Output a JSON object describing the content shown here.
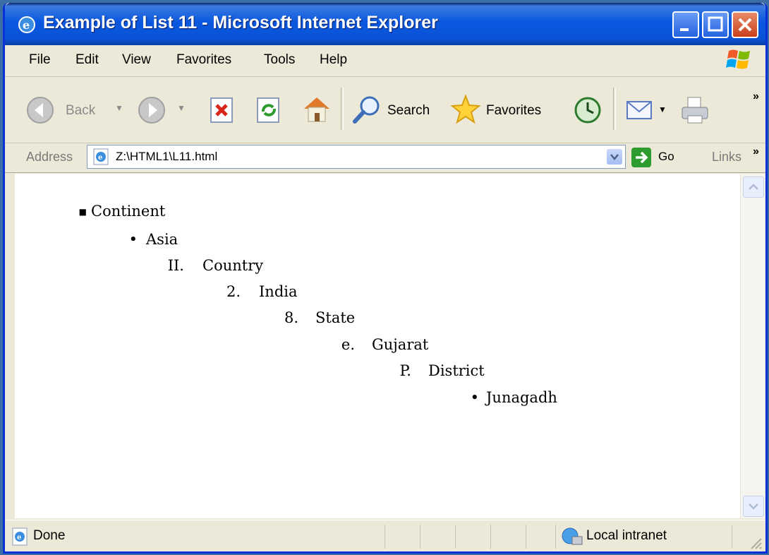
{
  "window": {
    "title": "Example of List 11 - Microsoft Internet Explorer"
  },
  "menu": {
    "items": [
      "File",
      "Edit",
      "View",
      "Favorites",
      "Tools",
      "Help"
    ]
  },
  "toolbar": {
    "back_label": "Back",
    "search_label": "Search",
    "favorites_label": "Favorites",
    "more_label": "»"
  },
  "address": {
    "label": "Address",
    "url": "Z:\\HTML1\\L11.html",
    "go_label": "Go",
    "links_label": "Links",
    "more_label": "»"
  },
  "list": {
    "items": [
      {
        "marker": "■",
        "text": "Continent"
      },
      {
        "marker": "•",
        "text": "Asia"
      },
      {
        "marker": "II.",
        "text": "Country"
      },
      {
        "marker": "2.",
        "text": "India"
      },
      {
        "marker": "8.",
        "text": "State"
      },
      {
        "marker": "e.",
        "text": "Gujarat"
      },
      {
        "marker": "P.",
        "text": "District"
      },
      {
        "marker": "•",
        "text": "Junagadh"
      }
    ]
  },
  "status": {
    "text": "Done",
    "zone": "Local intranet"
  },
  "colors": {
    "titlebar": "#0a53d6",
    "accent": "#0831d9",
    "go_green": "#2e9b2e"
  }
}
